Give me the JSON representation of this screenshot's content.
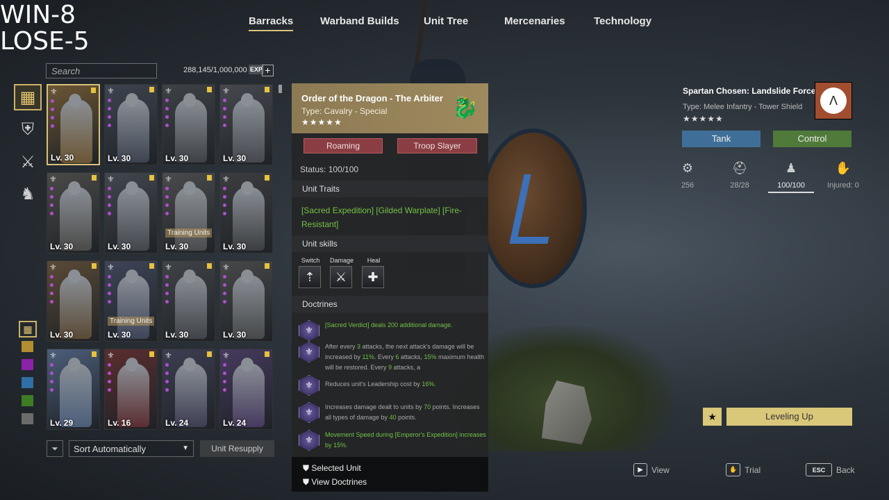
{
  "score": {
    "win": "WIN-8",
    "lose": "LOSE-5"
  },
  "nav": {
    "tabs": [
      "Barracks",
      "Warband Builds",
      "Unit Tree",
      "Mercenaries",
      "Technology"
    ],
    "active": "Barracks"
  },
  "search": {
    "placeholder": "Search"
  },
  "exp": {
    "text": "288,145/1,000,000",
    "badge": "EXP",
    "plus": "+"
  },
  "sidebar": {
    "tabs": [
      "grid-icon",
      "shield-icon",
      "crossed-spears-icon",
      "horse-icon"
    ],
    "filter_colors": [
      "#b08e2f",
      "#8a23a8",
      "#2f6ea6",
      "#3d7d24",
      "#6b6b6b"
    ]
  },
  "units": [
    {
      "lv": "Lv. 30",
      "bg": "#6b5634",
      "tag": ""
    },
    {
      "lv": "Lv. 30",
      "bg": "#3d4450",
      "tag": ""
    },
    {
      "lv": "Lv. 30",
      "bg": "#3e4246",
      "tag": ""
    },
    {
      "lv": "Lv. 30",
      "bg": "#46484f",
      "tag": ""
    },
    {
      "lv": "Lv. 30",
      "bg": "#4a4a48",
      "tag": ""
    },
    {
      "lv": "Lv. 30",
      "bg": "#42474e",
      "tag": ""
    },
    {
      "lv": "Lv. 30",
      "bg": "#4a4b4d",
      "tag": "Training Units"
    },
    {
      "lv": "Lv. 30",
      "bg": "#3b3d40",
      "tag": ""
    },
    {
      "lv": "Lv. 30",
      "bg": "#5a4a36",
      "tag": ""
    },
    {
      "lv": "Lv. 30",
      "bg": "#3d4558",
      "tag": "Training Units"
    },
    {
      "lv": "Lv. 30",
      "bg": "#404347",
      "tag": ""
    },
    {
      "lv": "Lv. 30",
      "bg": "#464849",
      "tag": ""
    },
    {
      "lv": "Lv. 29",
      "bg": "#4c5e7a",
      "tag": ""
    },
    {
      "lv": "Lv. 16",
      "bg": "#5a2e30",
      "tag": ""
    },
    {
      "lv": "Lv. 24",
      "bg": "#3d3e52",
      "tag": ""
    },
    {
      "lv": "Lv. 24",
      "bg": "#463a5e",
      "tag": ""
    }
  ],
  "controls": {
    "sort": "Sort Automatically",
    "resupply": "Unit Resupply"
  },
  "detail": {
    "name": "Order of the Dragon - The Arbiter",
    "type": "Type: Cavalry - Special",
    "stars": "★★★★★",
    "pills": [
      "Roaming",
      "Troop Slayer"
    ],
    "status": "Status: 100/100",
    "traits_title": "Unit Traits",
    "traits": "[Sacred Expedition] [Gilded Warplate] [Fire-Resistant]",
    "skills_title": "Unit skills",
    "skills": [
      {
        "label": "Switch",
        "icon": "lance-icon"
      },
      {
        "label": "Damage",
        "icon": "sword-icon"
      },
      {
        "label": "Heal",
        "icon": "heal-icon"
      }
    ],
    "doctrines_title": "Doctrines",
    "doctrines": [
      {
        "pre": "",
        "hl": "[Sacred Verdict] deals 200 additional damage.",
        "post": ""
      },
      {
        "t1": "After every ",
        "n1": "3",
        "t2": " attacks, the next attack's damage will be increased by ",
        "n2": "11%",
        "t3": ". Every ",
        "n3": "6",
        "t4": " attacks, ",
        "n4": "15%",
        "t5": " maximum health will be restored. Every ",
        "n5": "9",
        "t6": " attacks, a"
      },
      {
        "t1": "Reduces unit's Leadership cost by ",
        "n1": "16%",
        "t2": "."
      },
      {
        "t1": "Increases damage dealt to units by ",
        "n1": "70",
        "t2": " points. Increases all types of damage by ",
        "n2": "40",
        "t3": " points."
      },
      {
        "hl": "Movement Speed during [Emperor's Expedition] increases by 15%."
      }
    ],
    "footer": [
      "Selected Unit",
      "View Doctrines"
    ]
  },
  "right": {
    "name": "Spartan Chosen: Landslide Force",
    "type": "Type: Melee Infantry - Tower Shield",
    "stars": "★★★★★",
    "roles": [
      {
        "label": "Tank",
        "color": "#3f6f98"
      },
      {
        "label": "Control",
        "color": "#4f7a3a"
      }
    ],
    "stats": [
      {
        "icon": "gear-icon",
        "value": "256"
      },
      {
        "icon": "helmet-icon",
        "value": "28/28"
      },
      {
        "icon": "troop-icon",
        "value": "100/100"
      },
      {
        "icon": "injured-icon",
        "value": "Injured: 0"
      }
    ],
    "leveling": "Leveling Up",
    "hints": [
      {
        "key": "▶",
        "label": "View"
      },
      {
        "key": "✋",
        "label": "Trial"
      },
      {
        "key": "ESC",
        "label": "Back"
      }
    ]
  }
}
